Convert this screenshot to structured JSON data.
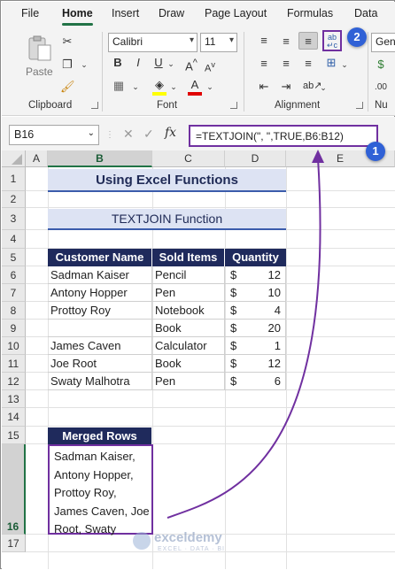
{
  "menu": {
    "tabs": [
      "File",
      "Home",
      "Insert",
      "Draw",
      "Page Layout",
      "Formulas",
      "Data"
    ],
    "active": "Home"
  },
  "ribbon": {
    "paste_label": "Paste",
    "clipboard_label": "Clipboard",
    "font_label": "Font",
    "alignment_label": "Alignment",
    "font_name": "Calibri",
    "font_size": "11",
    "number_format": "Gene",
    "number_label": "Nu"
  },
  "formula_bar": {
    "name_box": "B16",
    "fx": "fx",
    "formula": "=TEXTJOIN(\", \",TRUE,B6:B12)"
  },
  "columns": [
    "A",
    "B",
    "C",
    "D",
    "E"
  ],
  "rows": [
    "1",
    "2",
    "3",
    "4",
    "5",
    "6",
    "7",
    "8",
    "9",
    "10",
    "11",
    "12",
    "13",
    "14",
    "15",
    "16",
    "17"
  ],
  "sheet": {
    "title": "Using Excel Functions",
    "subtitle": "TEXTJOIN Function",
    "headers": [
      "Customer Name",
      "Sold Items",
      "Quantity"
    ],
    "table": [
      {
        "name": "Sadman Kaiser",
        "item": "Pencil",
        "cur": "$",
        "qty": "12"
      },
      {
        "name": "Antony Hopper",
        "item": "Pen",
        "cur": "$",
        "qty": "10"
      },
      {
        "name": "Prottoy Roy",
        "item": "Notebook",
        "cur": "$",
        "qty": "4"
      },
      {
        "name": "",
        "item": "Book",
        "cur": "$",
        "qty": "20"
      },
      {
        "name": "James Caven",
        "item": "Calculator",
        "cur": "$",
        "qty": "1"
      },
      {
        "name": "Joe Root",
        "item": "Book",
        "cur": "$",
        "qty": "12"
      },
      {
        "name": "Swaty Malhotra",
        "item": "Pen",
        "cur": "$",
        "qty": "6"
      }
    ],
    "merged_header": "Merged Rows",
    "merged_lines": [
      "Sadman Kaiser,",
      "Antony Hopper,",
      "Prottoy Roy,",
      "James Caven, Joe",
      "Root, Swaty"
    ]
  },
  "callouts": [
    "1",
    "2"
  ],
  "watermark": {
    "name": "exceldemy",
    "tagline": "EXCEL · DATA · BI"
  },
  "colors": {
    "accent": "#7030a0",
    "header_fill": "#1f2a5c",
    "title_fill": "#dde3f3",
    "callout": "#3061d6"
  }
}
